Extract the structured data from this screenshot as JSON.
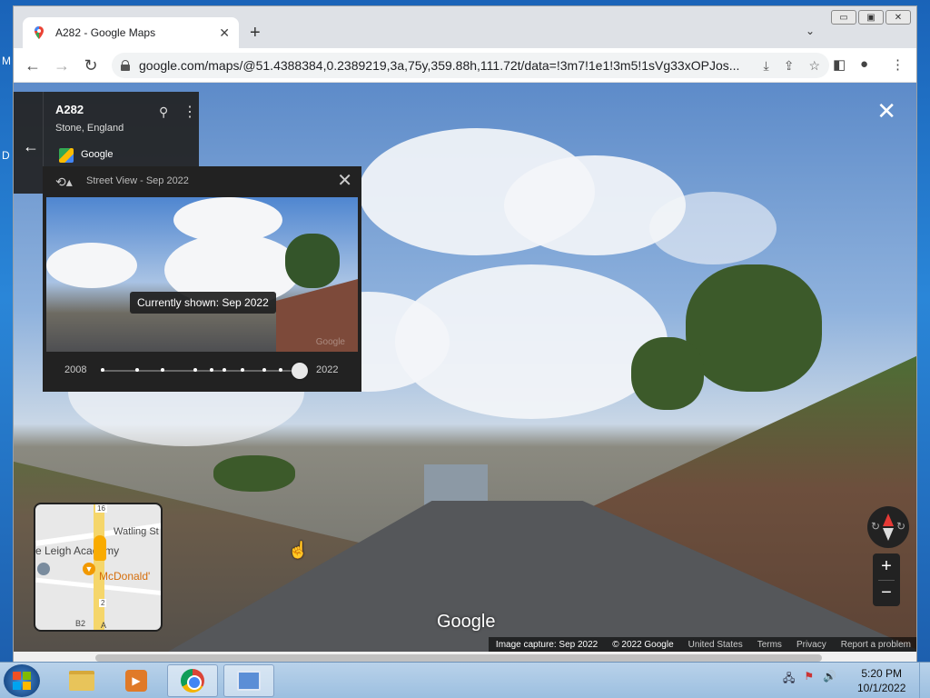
{
  "desktop": {
    "letters": [
      "M",
      "D"
    ]
  },
  "browser": {
    "tab_title": "A282 - Google Maps",
    "tab_close": "✕",
    "new_tab": "+",
    "tab_menu": "⌄",
    "window_controls": {
      "minimize": "▭",
      "maximize": "▣",
      "close": "✕"
    },
    "back": "←",
    "forward": "→",
    "reload": "↻",
    "url": "google.com/maps/@51.4388384,0.2389219,3a,75y,359.88h,111.72t/data=!3m7!1e1!3m5!1sVg33xOPJos...",
    "icons": [
      "download-icon",
      "share-icon",
      "star-icon",
      "side-panel-icon",
      "profile-icon",
      "menu-icon"
    ]
  },
  "streetview": {
    "close": "✕",
    "address": {
      "title": "A282",
      "subtitle": "Stone, England",
      "source": "Google",
      "back": "←"
    },
    "time_machine": {
      "title": "Street View - Sep 2022",
      "tooltip": "Currently shown: Sep 2022",
      "year_start": "2008",
      "year_end": "2022",
      "selected_index": 9,
      "dot_count": 10,
      "close": "✕"
    },
    "minimap": {
      "labels": {
        "road_top": "16",
        "watling": "Watling St",
        "academy": "e Leigh Academy",
        "mcdonalds": "McDonald'",
        "road_shield_2": "2",
        "road_b": "B2",
        "road_a": "A"
      }
    },
    "compass_rotate": "↻",
    "zoom_in": "+",
    "zoom_out": "−",
    "watermark": "Google",
    "footer": {
      "capture": "Image capture: Sep 2022",
      "copyright": "© 2022 Google",
      "country": "United States",
      "terms": "Terms",
      "privacy": "Privacy",
      "report": "Report a problem"
    }
  },
  "taskbar": {
    "clock_time": "5:20 PM",
    "clock_date": "10/1/2022",
    "tray_icons": [
      "network-icon",
      "flag-icon",
      "volume-icon"
    ]
  },
  "colors": {
    "accent_blue": "#4285f4",
    "compass_red": "#e53935",
    "mcd_orange": "#f29900"
  }
}
